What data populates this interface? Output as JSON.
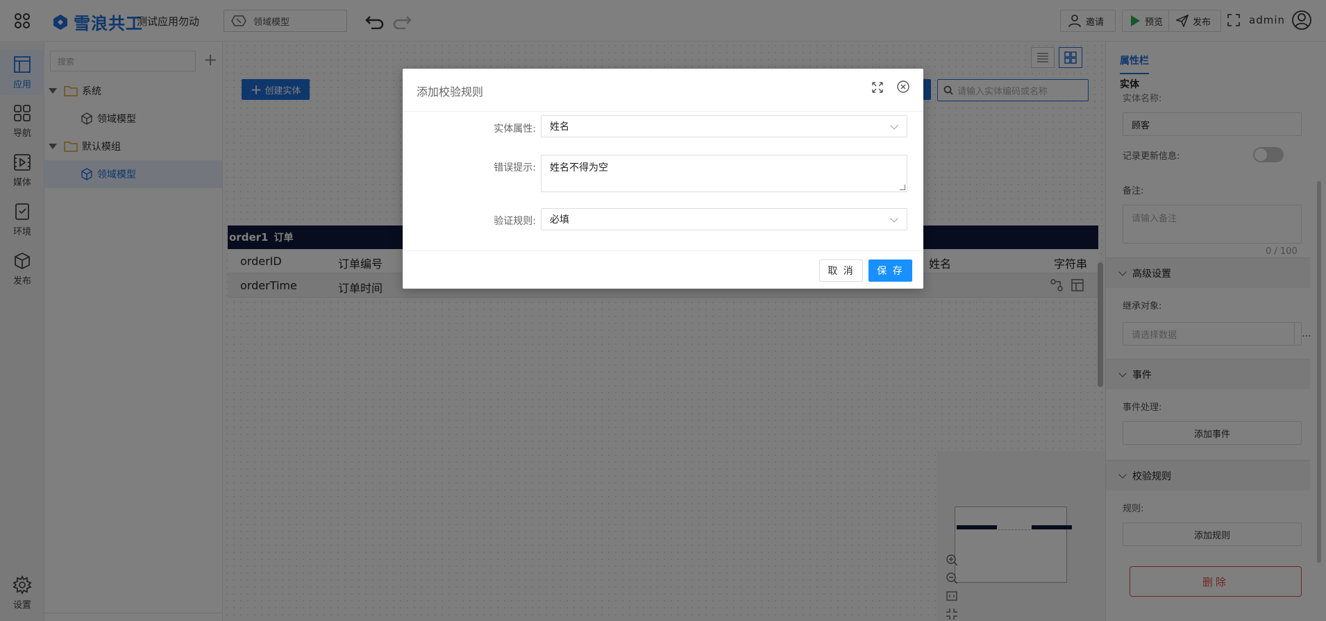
{
  "topbar": {
    "logo_text": "雪浪共工",
    "app_name": "测试应用勿动",
    "model_select": "领域模型",
    "invite_label": "邀请",
    "preview_label": "预览",
    "publish_label": "发布",
    "user": "admin",
    "accent_color": "#1e6fd9"
  },
  "rail": {
    "items": [
      {
        "label": "应用",
        "icon": "app-layout-icon"
      },
      {
        "label": "导航",
        "icon": "grid-icon"
      },
      {
        "label": "媒体",
        "icon": "media-icon"
      },
      {
        "label": "环境",
        "icon": "environment-icon"
      },
      {
        "label": "发布",
        "icon": "cube-icon"
      }
    ],
    "settings_label": "设置"
  },
  "tree": {
    "search_placeholder": "搜索",
    "nodes": [
      {
        "label": "系统"
      },
      {
        "label": "领域模型"
      },
      {
        "label": "默认模组"
      },
      {
        "label": "领域模型"
      }
    ]
  },
  "canvas": {
    "create_button": "创建实体",
    "search_placeholder": "请输入实体编码或名称",
    "entity_header": {
      "code": "order1",
      "name": "订单"
    },
    "rows": [
      {
        "field": "orderID",
        "label": "订单编号",
        "right_label": "姓名",
        "right_type": "字符串"
      },
      {
        "field": "orderTime",
        "label": "订单时间"
      }
    ]
  },
  "props": {
    "tab": "属性栏",
    "section": "实体",
    "cutoff_label": "实体名称:",
    "entity_name": "顾客",
    "record_update_label": "记录更新信息:",
    "remark_label": "备注:",
    "remark_placeholder": "请输入备注",
    "remark_counter": "0 / 100",
    "advanced_title": "高级设置",
    "inherit_label": "继承对象:",
    "inherit_placeholder": "请选择数据",
    "inherit_button": "...",
    "events_title": "事件",
    "event_label": "事件处理:",
    "add_event": "添加事件",
    "validation_title": "校验规则",
    "rule_label": "规则:",
    "add_rule": "添加规则",
    "delete": "删除"
  },
  "dialog": {
    "title": "添加校验规则",
    "fields": {
      "attribute_label": "实体属性:",
      "attribute_value": "姓名",
      "error_label": "错误提示:",
      "error_value": "姓名不得为空",
      "rule_label": "验证规则:",
      "rule_value": "必填"
    },
    "cancel": "取 消",
    "save": "保 存"
  }
}
